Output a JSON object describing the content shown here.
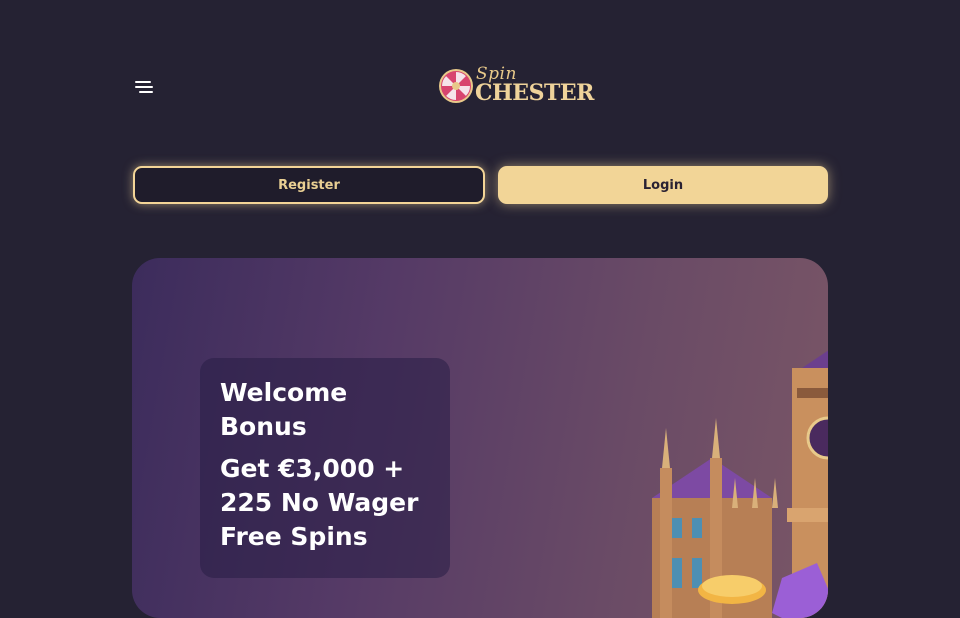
{
  "header": {
    "menu_icon": "hamburger-menu-icon",
    "logo": {
      "line1": "Spin",
      "line2": "CHESTER",
      "icon": "roulette-wheel-icon"
    }
  },
  "auth": {
    "register_label": "Register",
    "login_label": "Login"
  },
  "hero": {
    "title": "Welcome Bonus",
    "offer": "Get €3,000 + 225 No Wager Free Spins",
    "image": "castle-illustration"
  },
  "colors": {
    "background": "#252233",
    "accent_gold": "#f2d597",
    "logo_pink": "#d8456f"
  }
}
